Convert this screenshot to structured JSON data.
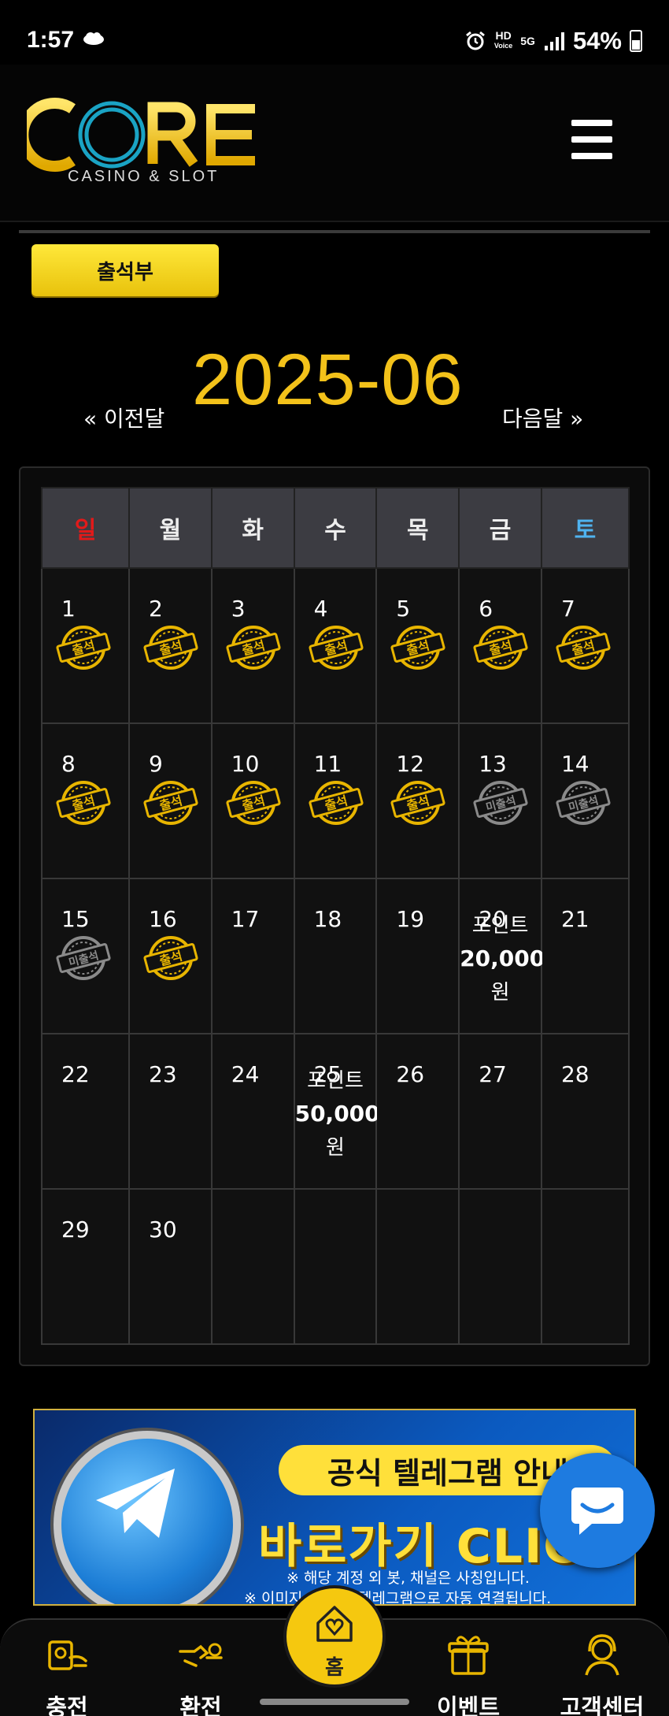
{
  "status_bar": {
    "time": "1:57",
    "hd_label": "HD",
    "voice_label": "Voice",
    "network": "5G",
    "battery": "54%"
  },
  "header": {
    "logo_text": "CORE",
    "logo_subtitle": "CASINO & SLOT"
  },
  "tab": {
    "label": "출석부"
  },
  "calendar": {
    "prev_label": "« 이전달",
    "next_label": "다음달 »",
    "month": "2025-06",
    "weekdays": [
      "일",
      "월",
      "화",
      "수",
      "목",
      "금",
      "토"
    ],
    "stamp_attended": "출석",
    "stamp_missed": "미출석",
    "weeks": [
      [
        {
          "day": "1",
          "stamp": "attended"
        },
        {
          "day": "2",
          "stamp": "attended"
        },
        {
          "day": "3",
          "stamp": "attended"
        },
        {
          "day": "4",
          "stamp": "attended"
        },
        {
          "day": "5",
          "stamp": "attended"
        },
        {
          "day": "6",
          "stamp": "attended"
        },
        {
          "day": "7",
          "stamp": "attended"
        }
      ],
      [
        {
          "day": "8",
          "stamp": "attended"
        },
        {
          "day": "9",
          "stamp": "attended"
        },
        {
          "day": "10",
          "stamp": "attended"
        },
        {
          "day": "11",
          "stamp": "attended"
        },
        {
          "day": "12",
          "stamp": "attended"
        },
        {
          "day": "13",
          "stamp": "missed"
        },
        {
          "day": "14",
          "stamp": "missed"
        }
      ],
      [
        {
          "day": "15",
          "stamp": "missed"
        },
        {
          "day": "16",
          "stamp": "attended"
        },
        {
          "day": "17"
        },
        {
          "day": "18"
        },
        {
          "day": "19"
        },
        {
          "day": "20",
          "point_label": "포인트",
          "point_amount": "20,000",
          "point_unit": "원"
        },
        {
          "day": "21"
        }
      ],
      [
        {
          "day": "22"
        },
        {
          "day": "23"
        },
        {
          "day": "24"
        },
        {
          "day": "25",
          "point_label": "포인트",
          "point_amount": "50,000",
          "point_unit": "원"
        },
        {
          "day": "26"
        },
        {
          "day": "27"
        },
        {
          "day": "28"
        }
      ],
      [
        {
          "day": "29"
        },
        {
          "day": "30"
        },
        {},
        {},
        {},
        {},
        {}
      ]
    ]
  },
  "banner": {
    "pill": "공식 텔레그램 안내",
    "headline": "바로가기 CLICK",
    "note1": "※ 해당 계정 외 봇, 채널은 사칭입니다.",
    "note2": "※ 이미지 클릭 시 텔레그램으로 자동 연결됩니다."
  },
  "bottom_nav": {
    "items": [
      {
        "label": "충전",
        "icon": "deposit-icon"
      },
      {
        "label": "환전",
        "icon": "withdraw-icon"
      },
      {
        "label": "홈",
        "icon": "home-heart-icon"
      },
      {
        "label": "이벤트",
        "icon": "gift-icon"
      },
      {
        "label": "고객센터",
        "icon": "support-icon"
      }
    ]
  },
  "colors": {
    "accent": "#f3c21a",
    "sunday": "#e21a1a",
    "saturday": "#4fb3f0",
    "chat": "#1e7be0"
  }
}
